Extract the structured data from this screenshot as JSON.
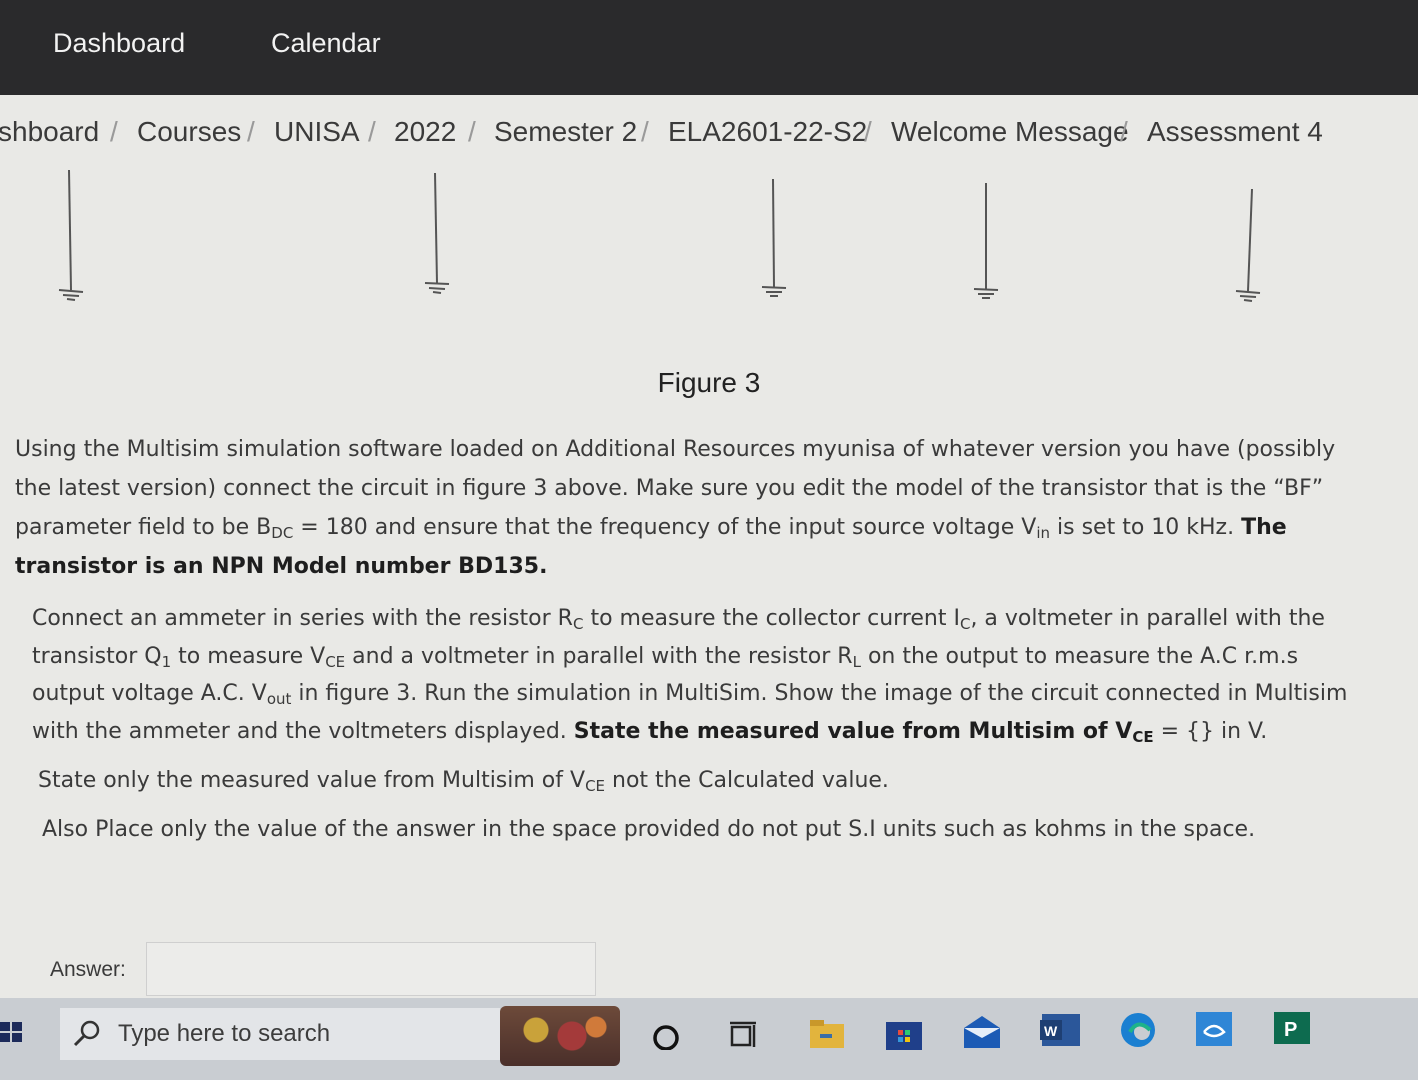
{
  "topnav": {
    "dashboard": "Dashboard",
    "calendar": "Calendar"
  },
  "breadcrumb": {
    "items": [
      "shboard",
      "Courses",
      "UNISA",
      "2022",
      "Semester 2",
      "ELA2601-22-S2",
      "Welcome Message",
      "Assessment 4"
    ],
    "separator": "/"
  },
  "figure": {
    "caption": "Figure 3"
  },
  "question": {
    "p1_l1": "Using the Multisim simulation software loaded on Additional Resources myunisa of whatever version you have (possibly",
    "p1_l2": "the latest version) connect the circuit in figure 3 above. Make sure you edit the model of the transistor that is the “BF”",
    "p1_l3a": "parameter field to be B",
    "p1_l3_sub1": "DC",
    "p1_l3b": " = 180 and ensure that the frequency of the input source voltage V",
    "p1_l3_sub2": "in",
    "p1_l3c": " is set to 10 kHz. ",
    "p1_l3_bold": "The",
    "p1_l4_bold": "transistor is an NPN Model number BD135.",
    "p2_l1a": "Connect an ammeter in series with the resistor R",
    "p2_l1_sub1": "C",
    "p2_l1b": " to measure the collector current I",
    "p2_l1_sub2": "C",
    "p2_l1c": ", a voltmeter in parallel with the",
    "p2_l2a": "transistor Q",
    "p2_l2_sub1": "1",
    "p2_l2b": " to measure V",
    "p2_l2_sub2": "CE",
    "p2_l2c": " and a voltmeter in parallel with the resistor R",
    "p2_l2_sub3": "L",
    "p2_l2d": " on the output to measure the A.C r.m.s",
    "p2_l3a": "output voltage A.C. V",
    "p2_l3_sub1": "out",
    "p2_l3b": " in figure 3. Run the simulation in MultiSim. Show the image of the circuit connected in Multisim",
    "p2_l4a": "with the ammeter and the voltmeters displayed. ",
    "p2_l4_bold": "State the measured value from Multisim of V",
    "p2_l4_bold_sub": "CE",
    "p2_l4b": " = {} in V.",
    "p3a": "State only the measured value from Multisim of V",
    "p3_sub": "CE",
    "p3b": " not the Calculated value.",
    "p4": "Also Place only the value of the answer in the space provided do not put S.I units such as kohms in the space."
  },
  "answer": {
    "label": "Answer:",
    "value": "",
    "placeholder": ""
  },
  "taskbar": {
    "search_placeholder": "Type here to search",
    "icons": [
      "start-icon",
      "search-icon",
      "cortana-icon",
      "task-view-icon",
      "file-explorer-icon",
      "store-icon",
      "mail-icon",
      "word-icon",
      "edge-icon",
      "vpn-icon",
      "publisher-icon"
    ],
    "word_letter": "W",
    "publisher_letter": "P"
  }
}
